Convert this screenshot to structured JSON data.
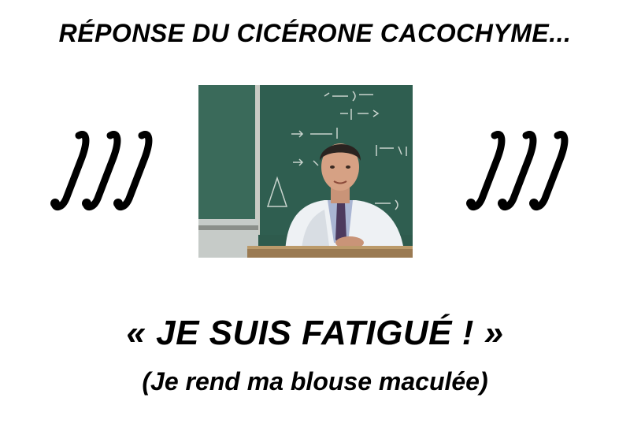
{
  "header": {
    "title": "RÉPONSE DU CICÉRONE CACOCHYME..."
  },
  "decorations": {
    "left_icon": "triple-integral-icon",
    "right_icon": "triple-integral-icon"
  },
  "photo": {
    "subject": "lecturer-at-blackboard-photo",
    "board_lines": [
      "∀x∈[a,b], ∀z∈[a,b]",
      "|f'(x)| ≤ k",
      "⇒ ∀x∈[a,",
      "|f(x)| < 1",
      "→ ∀x | < 1"
    ]
  },
  "quote": {
    "main": "« JE SUIS FATIGUÉ ! »",
    "sub": "(Je rend ma blouse maculée)"
  },
  "colors": {
    "background": "#ffffff",
    "text": "#000000",
    "board": "#2f5a4c"
  }
}
